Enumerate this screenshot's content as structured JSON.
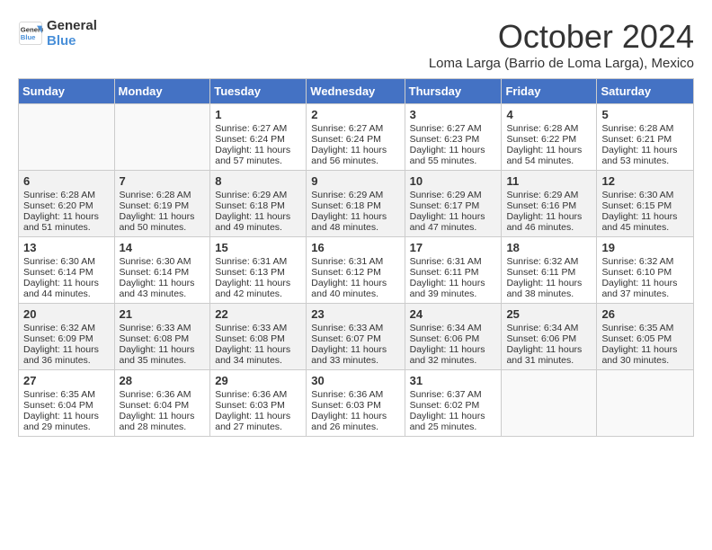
{
  "header": {
    "logo_line1": "General",
    "logo_line2": "Blue",
    "month": "October 2024",
    "location": "Loma Larga (Barrio de Loma Larga), Mexico"
  },
  "days_of_week": [
    "Sunday",
    "Monday",
    "Tuesday",
    "Wednesday",
    "Thursday",
    "Friday",
    "Saturday"
  ],
  "weeks": [
    [
      {
        "day": "",
        "sunrise": "",
        "sunset": "",
        "daylight": ""
      },
      {
        "day": "",
        "sunrise": "",
        "sunset": "",
        "daylight": ""
      },
      {
        "day": "1",
        "sunrise": "Sunrise: 6:27 AM",
        "sunset": "Sunset: 6:24 PM",
        "daylight": "Daylight: 11 hours and 57 minutes."
      },
      {
        "day": "2",
        "sunrise": "Sunrise: 6:27 AM",
        "sunset": "Sunset: 6:24 PM",
        "daylight": "Daylight: 11 hours and 56 minutes."
      },
      {
        "day": "3",
        "sunrise": "Sunrise: 6:27 AM",
        "sunset": "Sunset: 6:23 PM",
        "daylight": "Daylight: 11 hours and 55 minutes."
      },
      {
        "day": "4",
        "sunrise": "Sunrise: 6:28 AM",
        "sunset": "Sunset: 6:22 PM",
        "daylight": "Daylight: 11 hours and 54 minutes."
      },
      {
        "day": "5",
        "sunrise": "Sunrise: 6:28 AM",
        "sunset": "Sunset: 6:21 PM",
        "daylight": "Daylight: 11 hours and 53 minutes."
      }
    ],
    [
      {
        "day": "6",
        "sunrise": "Sunrise: 6:28 AM",
        "sunset": "Sunset: 6:20 PM",
        "daylight": "Daylight: 11 hours and 51 minutes."
      },
      {
        "day": "7",
        "sunrise": "Sunrise: 6:28 AM",
        "sunset": "Sunset: 6:19 PM",
        "daylight": "Daylight: 11 hours and 50 minutes."
      },
      {
        "day": "8",
        "sunrise": "Sunrise: 6:29 AM",
        "sunset": "Sunset: 6:18 PM",
        "daylight": "Daylight: 11 hours and 49 minutes."
      },
      {
        "day": "9",
        "sunrise": "Sunrise: 6:29 AM",
        "sunset": "Sunset: 6:18 PM",
        "daylight": "Daylight: 11 hours and 48 minutes."
      },
      {
        "day": "10",
        "sunrise": "Sunrise: 6:29 AM",
        "sunset": "Sunset: 6:17 PM",
        "daylight": "Daylight: 11 hours and 47 minutes."
      },
      {
        "day": "11",
        "sunrise": "Sunrise: 6:29 AM",
        "sunset": "Sunset: 6:16 PM",
        "daylight": "Daylight: 11 hours and 46 minutes."
      },
      {
        "day": "12",
        "sunrise": "Sunrise: 6:30 AM",
        "sunset": "Sunset: 6:15 PM",
        "daylight": "Daylight: 11 hours and 45 minutes."
      }
    ],
    [
      {
        "day": "13",
        "sunrise": "Sunrise: 6:30 AM",
        "sunset": "Sunset: 6:14 PM",
        "daylight": "Daylight: 11 hours and 44 minutes."
      },
      {
        "day": "14",
        "sunrise": "Sunrise: 6:30 AM",
        "sunset": "Sunset: 6:14 PM",
        "daylight": "Daylight: 11 hours and 43 minutes."
      },
      {
        "day": "15",
        "sunrise": "Sunrise: 6:31 AM",
        "sunset": "Sunset: 6:13 PM",
        "daylight": "Daylight: 11 hours and 42 minutes."
      },
      {
        "day": "16",
        "sunrise": "Sunrise: 6:31 AM",
        "sunset": "Sunset: 6:12 PM",
        "daylight": "Daylight: 11 hours and 40 minutes."
      },
      {
        "day": "17",
        "sunrise": "Sunrise: 6:31 AM",
        "sunset": "Sunset: 6:11 PM",
        "daylight": "Daylight: 11 hours and 39 minutes."
      },
      {
        "day": "18",
        "sunrise": "Sunrise: 6:32 AM",
        "sunset": "Sunset: 6:11 PM",
        "daylight": "Daylight: 11 hours and 38 minutes."
      },
      {
        "day": "19",
        "sunrise": "Sunrise: 6:32 AM",
        "sunset": "Sunset: 6:10 PM",
        "daylight": "Daylight: 11 hours and 37 minutes."
      }
    ],
    [
      {
        "day": "20",
        "sunrise": "Sunrise: 6:32 AM",
        "sunset": "Sunset: 6:09 PM",
        "daylight": "Daylight: 11 hours and 36 minutes."
      },
      {
        "day": "21",
        "sunrise": "Sunrise: 6:33 AM",
        "sunset": "Sunset: 6:08 PM",
        "daylight": "Daylight: 11 hours and 35 minutes."
      },
      {
        "day": "22",
        "sunrise": "Sunrise: 6:33 AM",
        "sunset": "Sunset: 6:08 PM",
        "daylight": "Daylight: 11 hours and 34 minutes."
      },
      {
        "day": "23",
        "sunrise": "Sunrise: 6:33 AM",
        "sunset": "Sunset: 6:07 PM",
        "daylight": "Daylight: 11 hours and 33 minutes."
      },
      {
        "day": "24",
        "sunrise": "Sunrise: 6:34 AM",
        "sunset": "Sunset: 6:06 PM",
        "daylight": "Daylight: 11 hours and 32 minutes."
      },
      {
        "day": "25",
        "sunrise": "Sunrise: 6:34 AM",
        "sunset": "Sunset: 6:06 PM",
        "daylight": "Daylight: 11 hours and 31 minutes."
      },
      {
        "day": "26",
        "sunrise": "Sunrise: 6:35 AM",
        "sunset": "Sunset: 6:05 PM",
        "daylight": "Daylight: 11 hours and 30 minutes."
      }
    ],
    [
      {
        "day": "27",
        "sunrise": "Sunrise: 6:35 AM",
        "sunset": "Sunset: 6:04 PM",
        "daylight": "Daylight: 11 hours and 29 minutes."
      },
      {
        "day": "28",
        "sunrise": "Sunrise: 6:36 AM",
        "sunset": "Sunset: 6:04 PM",
        "daylight": "Daylight: 11 hours and 28 minutes."
      },
      {
        "day": "29",
        "sunrise": "Sunrise: 6:36 AM",
        "sunset": "Sunset: 6:03 PM",
        "daylight": "Daylight: 11 hours and 27 minutes."
      },
      {
        "day": "30",
        "sunrise": "Sunrise: 6:36 AM",
        "sunset": "Sunset: 6:03 PM",
        "daylight": "Daylight: 11 hours and 26 minutes."
      },
      {
        "day": "31",
        "sunrise": "Sunrise: 6:37 AM",
        "sunset": "Sunset: 6:02 PM",
        "daylight": "Daylight: 11 hours and 25 minutes."
      },
      {
        "day": "",
        "sunrise": "",
        "sunset": "",
        "daylight": ""
      },
      {
        "day": "",
        "sunrise": "",
        "sunset": "",
        "daylight": ""
      }
    ]
  ]
}
